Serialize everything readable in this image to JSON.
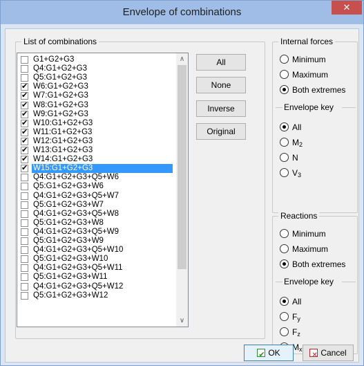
{
  "window": {
    "title": "Envelope of combinations",
    "close_glyph": "✕"
  },
  "list_group": {
    "title": "List of combinations",
    "items": [
      {
        "label": "G1+G2+G3",
        "checked": false,
        "selected": false
      },
      {
        "label": "Q4:G1+G2+G3",
        "checked": false,
        "selected": false
      },
      {
        "label": "Q5:G1+G2+G3",
        "checked": false,
        "selected": false
      },
      {
        "label": "W6:G1+G2+G3",
        "checked": true,
        "selected": false
      },
      {
        "label": "W7:G1+G2+G3",
        "checked": true,
        "selected": false
      },
      {
        "label": "W8:G1+G2+G3",
        "checked": true,
        "selected": false
      },
      {
        "label": "W9:G1+G2+G3",
        "checked": true,
        "selected": false
      },
      {
        "label": "W10:G1+G2+G3",
        "checked": true,
        "selected": false
      },
      {
        "label": "W11:G1+G2+G3",
        "checked": true,
        "selected": false
      },
      {
        "label": "W12:G1+G2+G3",
        "checked": true,
        "selected": false
      },
      {
        "label": "W13:G1+G2+G3",
        "checked": true,
        "selected": false
      },
      {
        "label": "W14:G1+G2+G3",
        "checked": true,
        "selected": false
      },
      {
        "label": "W15:G1+G2+G3",
        "checked": true,
        "selected": true
      },
      {
        "label": "Q4:G1+G2+G3+Q5+W6",
        "checked": false,
        "selected": false
      },
      {
        "label": "Q5:G1+G2+G3+W6",
        "checked": false,
        "selected": false
      },
      {
        "label": "Q4:G1+G2+G3+Q5+W7",
        "checked": false,
        "selected": false
      },
      {
        "label": "Q5:G1+G2+G3+W7",
        "checked": false,
        "selected": false
      },
      {
        "label": "Q4:G1+G2+G3+Q5+W8",
        "checked": false,
        "selected": false
      },
      {
        "label": "Q5:G1+G2+G3+W8",
        "checked": false,
        "selected": false
      },
      {
        "label": "Q4:G1+G2+G3+Q5+W9",
        "checked": false,
        "selected": false
      },
      {
        "label": "Q5:G1+G2+G3+W9",
        "checked": false,
        "selected": false
      },
      {
        "label": "Q4:G1+G2+G3+Q5+W10",
        "checked": false,
        "selected": false
      },
      {
        "label": "Q5:G1+G2+G3+W10",
        "checked": false,
        "selected": false
      },
      {
        "label": "Q4:G1+G2+G3+Q5+W11",
        "checked": false,
        "selected": false
      },
      {
        "label": "Q5:G1+G2+G3+W11",
        "checked": false,
        "selected": false
      },
      {
        "label": "Q4:G1+G2+G3+Q5+W12",
        "checked": false,
        "selected": false
      },
      {
        "label": "Q5:G1+G2+G3+W12",
        "checked": false,
        "selected": false
      }
    ],
    "buttons": {
      "all": "All",
      "none": "None",
      "inverse": "Inverse",
      "original": "Original"
    },
    "scroll_up_glyph": "∧",
    "scroll_down_glyph": "∨"
  },
  "internal_forces": {
    "title": "Internal forces",
    "extremes": [
      {
        "label": "Minimum",
        "on": false
      },
      {
        "label": "Maximum",
        "on": false
      },
      {
        "label": "Both extremes",
        "on": true
      }
    ],
    "envelope_key_title": "Envelope key",
    "keys": [
      {
        "base": "All",
        "sub": "",
        "on": true
      },
      {
        "base": "M",
        "sub": "2",
        "on": false
      },
      {
        "base": "N",
        "sub": "",
        "on": false
      },
      {
        "base": "V",
        "sub": "3",
        "on": false
      }
    ]
  },
  "reactions": {
    "title": "Reactions",
    "extremes": [
      {
        "label": "Minimum",
        "on": false
      },
      {
        "label": "Maximum",
        "on": false
      },
      {
        "label": "Both extremes",
        "on": true
      }
    ],
    "envelope_key_title": "Envelope key",
    "keys": [
      {
        "base": "All",
        "sub": "",
        "on": true
      },
      {
        "base": "F",
        "sub": "y",
        "on": false
      },
      {
        "base": "F",
        "sub": "z",
        "on": false
      },
      {
        "base": "M",
        "sub": "x",
        "on": false
      }
    ]
  },
  "footer": {
    "ok": "OK",
    "cancel": "Cancel"
  }
}
